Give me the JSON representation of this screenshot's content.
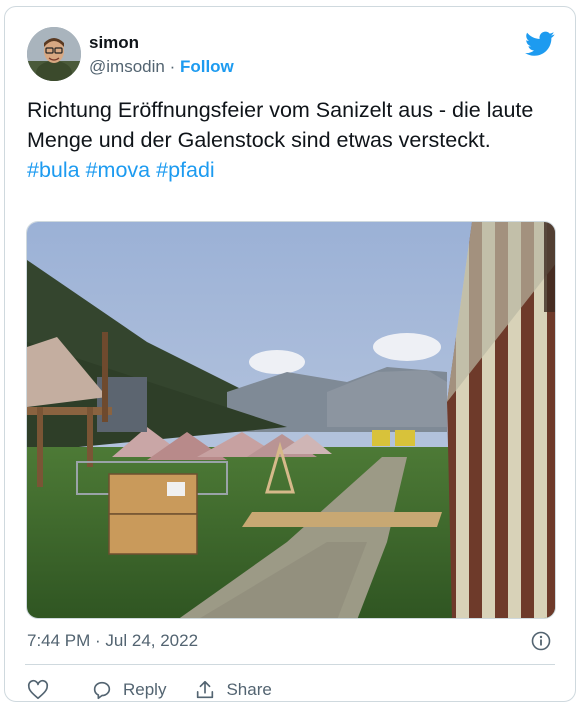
{
  "author": {
    "name": "simon",
    "handle": "@imsodin",
    "separator": " · ",
    "follow_label": "Follow"
  },
  "tweet": {
    "text": "Richtung Eröffnungsfeier vom Sanizelt aus - die laute Menge und der Galenstock sind etwas versteckt.",
    "hashtags": [
      "#bula",
      "#mova",
      "#pfadi"
    ],
    "timestamp": "7:44 PM · Jul 24, 2022"
  },
  "actions": {
    "reply_label": "Reply",
    "share_label": "Share"
  },
  "icons": {
    "brand": "twitter-bird-icon",
    "info": "info-icon",
    "like": "heart-icon",
    "reply": "reply-icon",
    "share": "share-icon"
  },
  "colors": {
    "accent": "#1d9bf0",
    "text": "#0f1419",
    "secondary": "#536471",
    "border": "#cfd9de"
  }
}
